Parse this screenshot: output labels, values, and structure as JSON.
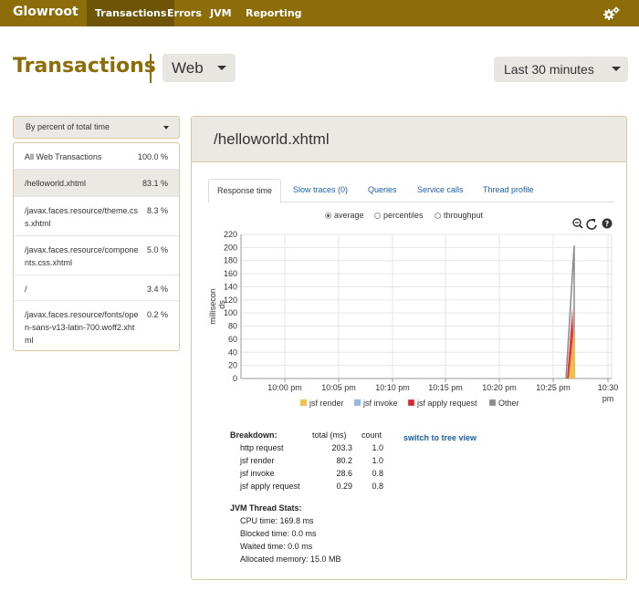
{
  "navbar": {
    "brand": "Glowroot",
    "items": [
      {
        "label": "Transactions",
        "active": true
      },
      {
        "label": "Errors",
        "active": false
      },
      {
        "label": "JVM",
        "active": false
      },
      {
        "label": "Reporting",
        "active": false
      }
    ],
    "settings_icon": "gear-icon"
  },
  "header": {
    "title": "Transactions",
    "type_selected": "Web",
    "time_range": "Last 30 minutes"
  },
  "sidebar": {
    "sort_label": "By percent of total time",
    "transactions": [
      {
        "name": "All Web Transactions",
        "percent": "100.0 %"
      },
      {
        "name": "/helloworld.xhtml",
        "percent": "83.1 %",
        "selected": true
      },
      {
        "name": "/javax.faces.resource/theme.css.xhtml",
        "percent": "8.3 %"
      },
      {
        "name": "/javax.faces.resource/components.css.xhtml",
        "percent": "5.0 %"
      },
      {
        "name": "/",
        "percent": "3.4 %"
      },
      {
        "name": "/javax.faces.resource/fonts/open-sans-v13-latin-700.woff2.xhtml",
        "percent": "0.2 %"
      }
    ]
  },
  "main": {
    "title": "/helloworld.xhtml",
    "tabs": [
      "Response time",
      "Slow traces (0)",
      "Queries",
      "Service calls",
      "Thread profile"
    ],
    "active_tab": "Response time",
    "view_options": [
      {
        "label": "average",
        "selected": true
      },
      {
        "label": "percentiles",
        "selected": false
      },
      {
        "label": "throughput",
        "selected": false
      }
    ],
    "chart_tool_icons": [
      "zoom-out-icon",
      "refresh-icon",
      "help-icon"
    ]
  },
  "chart_data": {
    "type": "area",
    "ylabel": "millisecon ds",
    "ylim": [
      0,
      220
    ],
    "yticks": [
      0,
      20,
      40,
      60,
      80,
      100,
      120,
      140,
      160,
      180,
      200,
      220
    ],
    "xticks": [
      "10:00 pm",
      "10:05 pm",
      "10:10 pm",
      "10:15 pm",
      "10:20 pm",
      "10:25 pm",
      "10:30 pm"
    ],
    "grid": true,
    "legend_placement": "bottom",
    "spike_time": "10:26 pm",
    "series": [
      {
        "name": "jsf render",
        "color": "#f5c342",
        "peak": 80
      },
      {
        "name": "jsf invoke",
        "color": "#93b8e0",
        "peak": 29
      },
      {
        "name": "jsf apply request",
        "color": "#d9262d",
        "peak": 109
      },
      {
        "name": "Other",
        "color": "#8a8a8a",
        "peak": 203
      }
    ]
  },
  "breakdown": {
    "heading": "Breakdown:",
    "col_total": "total (ms)",
    "col_count": "count",
    "tree_link": "switch to tree view",
    "rows": [
      {
        "name": "http request",
        "total": "203.3",
        "count": "1.0"
      },
      {
        "name": "jsf render",
        "total": "80.2",
        "count": "1.0"
      },
      {
        "name": "jsf invoke",
        "total": "28.6",
        "count": "0.8"
      },
      {
        "name": "jsf apply request",
        "total": "0.29",
        "count": "0.8"
      }
    ]
  },
  "jvm_stats": {
    "heading": "JVM Thread Stats:",
    "cpu": "CPU time: 169.8 ms",
    "blocked": "Blocked time: 0.0 ms",
    "waited": "Waited time: 0.0 ms",
    "allocated": "Allocated memory: 15.0 MB"
  }
}
